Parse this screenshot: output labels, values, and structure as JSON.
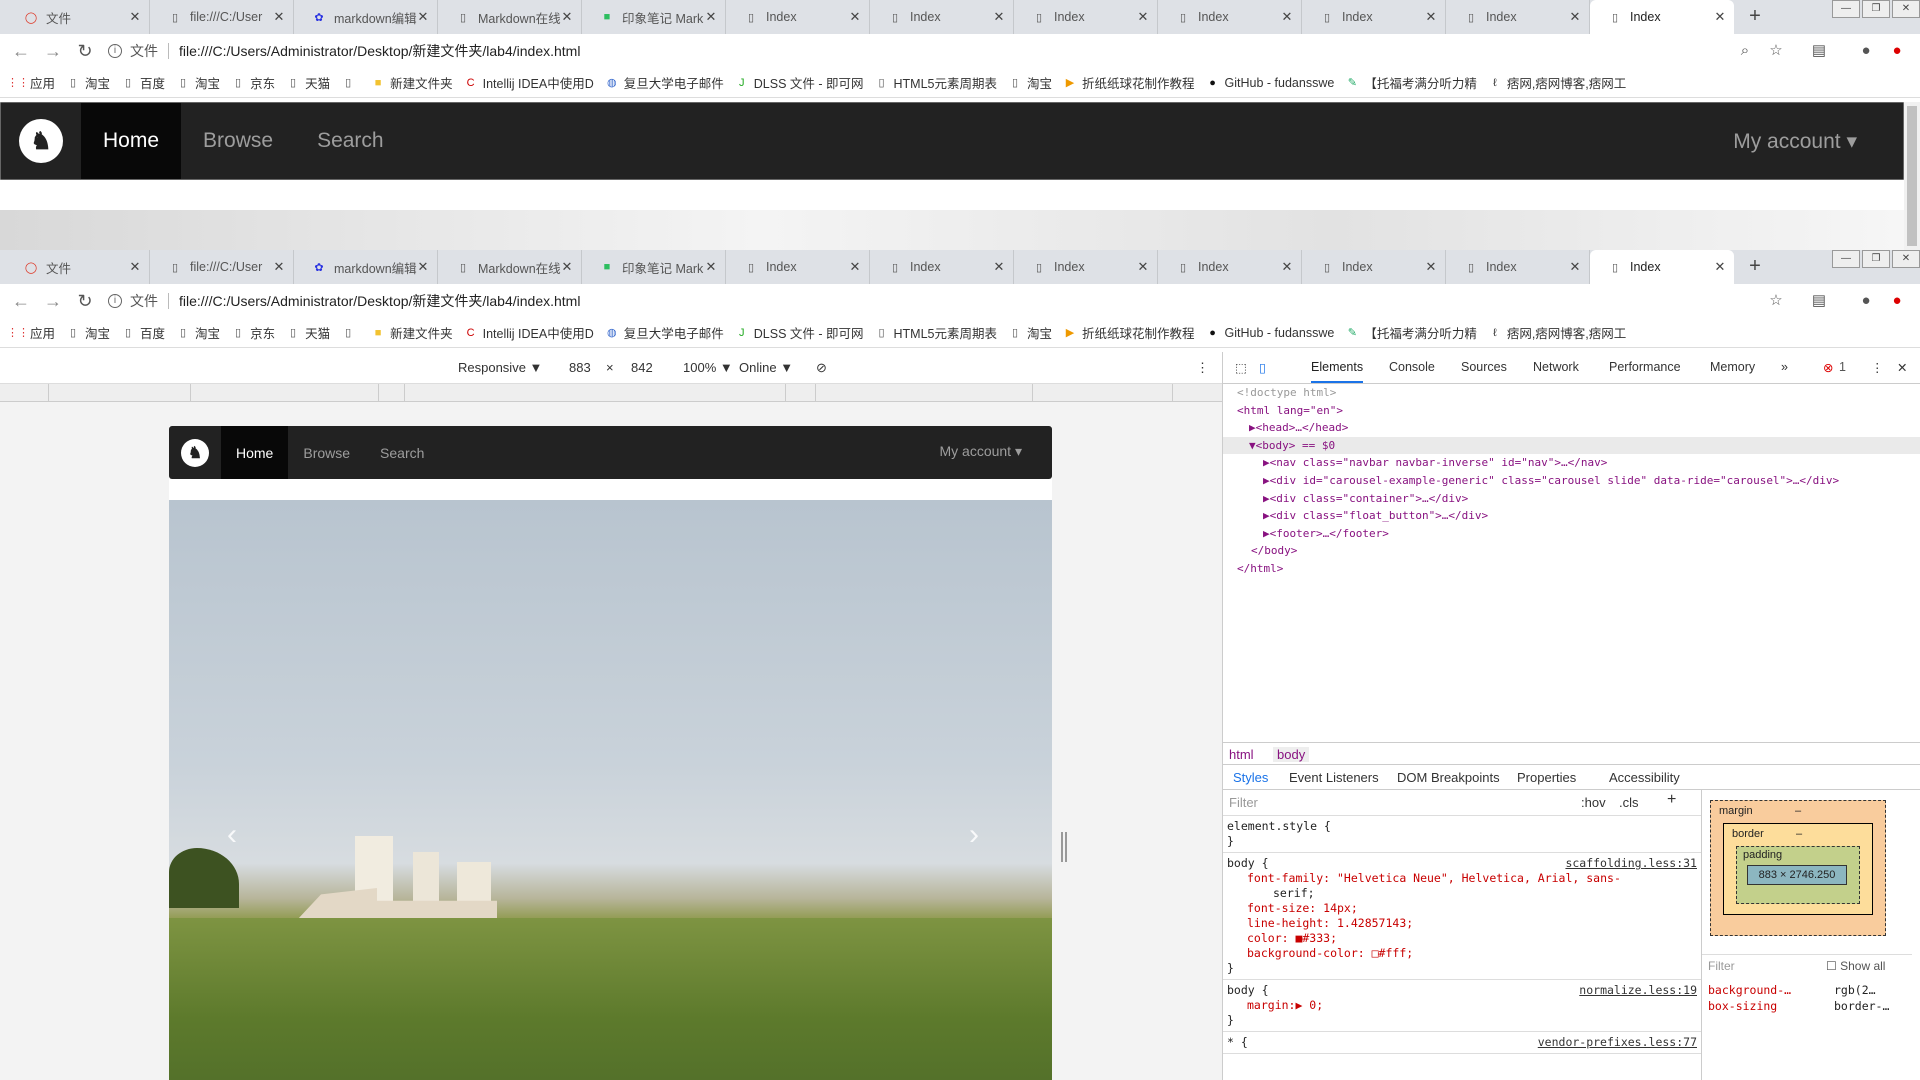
{
  "browser": {
    "tabs": [
      {
        "label": "文件",
        "icon": "opera-icon"
      },
      {
        "label": "file:///C:/User",
        "icon": "page-icon"
      },
      {
        "label": "markdown编辑",
        "icon": "baidu-icon"
      },
      {
        "label": "Markdown在线",
        "icon": "page-icon"
      },
      {
        "label": "印象笔记 Mark",
        "icon": "evernote-icon"
      },
      {
        "label": "Index",
        "icon": "page-icon"
      },
      {
        "label": "Index",
        "icon": "page-icon"
      },
      {
        "label": "Index",
        "icon": "page-icon"
      },
      {
        "label": "Index",
        "icon": "page-icon"
      },
      {
        "label": "Index",
        "icon": "page-icon"
      },
      {
        "label": "Index",
        "icon": "page-icon"
      },
      {
        "label": "Index",
        "icon": "page-icon"
      }
    ],
    "address": {
      "scheme_label": "文件",
      "url": "file:///C:/Users/Administrator/Desktop/新建文件夹/lab4/index.html"
    },
    "bookmarks": [
      {
        "label": "应用",
        "icon": "apps-grid-icon"
      },
      {
        "label": "淘宝",
        "icon": "page-icon"
      },
      {
        "label": "百度",
        "icon": "page-icon"
      },
      {
        "label": "淘宝",
        "icon": "page-icon"
      },
      {
        "label": "京东",
        "icon": "page-icon"
      },
      {
        "label": "天猫",
        "icon": "page-icon"
      },
      {
        "label": "",
        "icon": "page-icon"
      },
      {
        "label": "新建文件夹",
        "icon": "folder-icon"
      },
      {
        "label": "Intellij IDEA中使用D",
        "icon": "csdn-icon"
      },
      {
        "label": "复旦大学电子邮件",
        "icon": "fudan-icon"
      },
      {
        "label": "DLSS 文件 - 即可网",
        "icon": "jk-icon"
      },
      {
        "label": "HTML5元素周期表",
        "icon": "page-icon"
      },
      {
        "label": "淘宝",
        "icon": "page-icon"
      },
      {
        "label": "折纸纸球花制作教程",
        "icon": "bookmark-icon"
      },
      {
        "label": "GitHub - fudansswe",
        "icon": "github-icon"
      },
      {
        "label": "【托福考满分听力精",
        "icon": "leaf-icon"
      },
      {
        "label": "痞网,痞网博客,痞网工",
        "icon": "pi-icon"
      }
    ]
  },
  "site": {
    "nav": {
      "home": "Home",
      "browse": "Browse",
      "search": "Search",
      "account": "My account ▾"
    }
  },
  "devtools": {
    "toolbar": {
      "mode": "Responsive ▼",
      "width": "883",
      "times": "×",
      "height": "842",
      "zoom": "100% ▼",
      "network": "Online ▼"
    },
    "tabs": [
      "Elements",
      "Console",
      "Sources",
      "Network",
      "Performance",
      "Memory",
      "»"
    ],
    "errors": "1",
    "dom": {
      "doctype": "<!doctype html>",
      "html_open": "<html lang=\"en\">",
      "head": "▶<head>…</head>",
      "body": "▼<body> == $0",
      "nav": "▶<nav class=\"navbar navbar-inverse\" id=\"nav\">…</nav>",
      "carousel": "▶<div id=\"carousel-example-generic\" class=\"carousel slide\" data-ride=\"carousel\">…</div>",
      "container": "▶<div class=\"container\">…</div>",
      "float": "▶<div class=\"float_button\">…</div>",
      "footer": "▶<footer>…</footer>",
      "body_close": "</body>",
      "html_close": "</html>"
    },
    "crumbs": [
      "html",
      "body"
    ],
    "subtabs": [
      "Styles",
      "Event Listeners",
      "DOM Breakpoints",
      "Properties",
      "Accessibility"
    ],
    "styles": {
      "filter": "Filter",
      "hov": ":hov",
      "cls": ".cls",
      "element_style": "element.style {",
      "close": "}",
      "body_rule": "body {",
      "src1": "scaffolding.less:31",
      "p1": "font-family: \"Helvetica Neue\", Helvetica, Arial, sans-",
      "p1b": "serif;",
      "p2": "font-size: 14px;",
      "p3": "line-height: 1.42857143;",
      "p4": "color: ■#333;",
      "p5": "background-color: □#fff;",
      "src2": "normalize.less:19",
      "p6": "margin:▶ 0;",
      "star_rule": "* {",
      "src3": "vendor-prefixes.less:77"
    },
    "boxmodel": {
      "margin": "margin",
      "border": "border",
      "padding": "padding",
      "dash": "–",
      "size": "883 × 2746.250",
      "filter": "Filter",
      "showall": "Show all",
      "computed1": "background-…",
      "computed1v": "rgb(2…",
      "computed2": "box-sizing",
      "computed2v": "border-…"
    }
  },
  "colors": {
    "navbar": "#222222",
    "active": "#080808",
    "accent": "#1a73e8"
  }
}
